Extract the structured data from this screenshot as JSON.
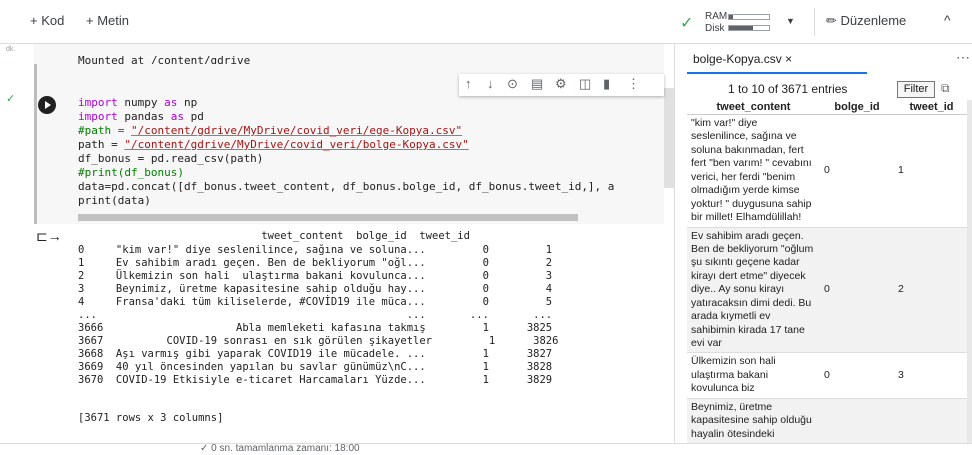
{
  "toolbar": {
    "add_code": "+ Kod",
    "add_text": "+ Metin",
    "ram_label": "RAM",
    "disk_label": "Disk",
    "editing_label": "Düzenleme",
    "ram_usage": 0.1,
    "disk_usage": 0.6
  },
  "gutter": {
    "label": "dk."
  },
  "output_cells": {
    "mounted_text": "Mounted at /content/gdrive"
  },
  "code_cell": {
    "lines": [
      "import numpy as np",
      "import pandas as pd",
      "#path = \"/content/gdrive/MyDrive/covid_veri/ege-Kopya.csv\"",
      "path = \"/content/gdrive/MyDrive/covid_veri/bolge-Kopya.csv\"",
      "df_bonus = pd.read_csv(path)",
      "#print(df_bonus)",
      "data=pd.concat([df_bonus.tweet_content, df_bonus.bolge_id, df_bonus.tweet_id,], a",
      "print(data)"
    ],
    "path_comment_prefix": "#path = ",
    "path_comment_str": "\"/content/gdrive/MyDrive/covid_veri/ege-Kopya.csv\"",
    "path_prefix": "path = ",
    "path_str": "\"/content/gdrive/MyDrive/covid_veri/bolge-Kopya.csv\"",
    "kw_import": "import",
    "kw_as": "as",
    "mod1": " numpy ",
    "alias1": " np",
    "mod2": " pandas ",
    "alias2": " pd",
    "line_readcsv": "df_bonus = pd.read_csv(path)",
    "line_printcomment": "#print(df_bonus)",
    "line_concat": "data=pd.concat([df_bonus.tweet_content, df_bonus.bolge_id, df_bonus.tweet_id,], a",
    "line_print": "print(data)"
  },
  "output": {
    "header": "                             tweet_content  bolge_id  tweet_id",
    "rows": [
      "0     \"kim var!\" diye seslenilince, sağına ve soluna...         0         1",
      "1     Ev sahibim aradı geçen. Ben de bekliyorum \"oğl...         0         2",
      "2     Ülkemizin son hali  ulaştırma bakani kovulunca...         0         3",
      "3     Beynimiz, üretme kapasitesine sahip olduğu hay...         0         4",
      "4     Fransa'daki tüm kiliselerde, #COVİD19 ile müca...         0         5",
      "...                                                 ...       ...       ...",
      "3666                     Abla memleketi kafasına takmış         1      3825",
      "3667          COVID-19 sonrası en sık görülen şikayetler         1      3826",
      "3668  Aşı varmış gibi yaparak COVID19 ile mücadele. ...         1      3827",
      "3669  40 yıl öncesinden yapılan bu savlar günümüz\\nC...         1      3828",
      "3670  COVID-19 Etkisiyle e-ticaret Harcamaları Yüzde...         1      3829"
    ],
    "summary": "[3671 rows x 3 columns]"
  },
  "bottom_bar": {
    "text": "✓ 0 sn.   tamamlanma zamanı: 18:00"
  },
  "right_panel": {
    "file_tab": "bolge-Kopya.csv",
    "close_symbol": "×",
    "more_symbol": "⋯",
    "entries_info": "1 to 10 of 3671 entries",
    "filter_label": "Filter",
    "columns": [
      "tweet_content",
      "bolge_id",
      "tweet_id"
    ],
    "rows": [
      {
        "tweet_content": "\"kim var!\" diye seslenilince, sağına ve soluna bakınmadan, fert fert \"ben varım! \" cevabını verici, her ferdi \"benim olmadığım yerde kimse yoktur! \" duygusuna sahip bir millet! Elhamdülillah!",
        "bolge_id": "0",
        "tweet_id": "1"
      },
      {
        "tweet_content": "Ev sahibim aradı geçen. Ben de bekliyorum \"oğlum şu sıkıntı geçene kadar kirayı dert etme\" diyecek diye.. Ay sonu kirayı yatıracaksın dimi dedi. Bu arada kıymetli ev sahibimin kirada 17 tane evi var",
        "bolge_id": "0",
        "tweet_id": "2"
      },
      {
        "tweet_content": "Ülkemizin son hali ulaştırma bakani kovulunca biz",
        "bolge_id": "0",
        "tweet_id": "3"
      },
      {
        "tweet_content": "Beynimiz, üretme kapasitesine sahip olduğu hayalin ötesindeki",
        "bolge_id": "",
        "tweet_id": ""
      }
    ]
  }
}
